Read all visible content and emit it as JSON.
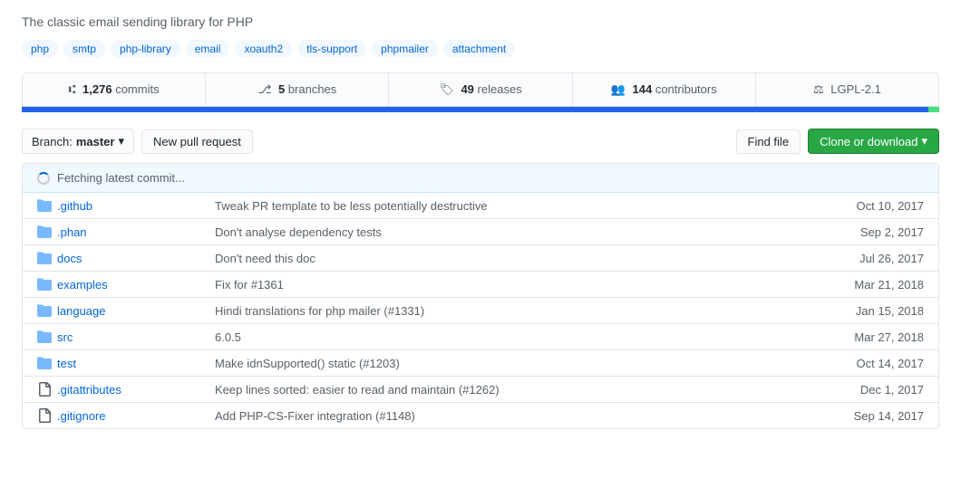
{
  "description": "The classic email sending library for PHP",
  "topics": [
    "php",
    "smtp",
    "php-library",
    "email",
    "xoauth2",
    "tls-support",
    "phpmailer",
    "attachment"
  ],
  "stats": {
    "commits": {
      "count": "1,276",
      "label": "commits"
    },
    "branches": {
      "count": "5",
      "label": "branches"
    },
    "releases": {
      "count": "49",
      "label": "releases"
    },
    "contributors": {
      "count": "144",
      "label": "contributors"
    },
    "license": {
      "label": "LGPL-2.1"
    }
  },
  "toolbar": {
    "branch_label": "Branch:",
    "branch_name": "master",
    "new_pr_label": "New pull request",
    "find_file_label": "Find file",
    "clone_label": "Clone or download"
  },
  "commit_header": "Fetching latest commit...",
  "files": [
    {
      "name": ".github",
      "type": "folder",
      "message": "Tweak PR template to be less potentially destructive",
      "date": "Oct 10, 2017"
    },
    {
      "name": ".phan",
      "type": "folder",
      "message": "Don't analyse dependency tests",
      "date": "Sep 2, 2017"
    },
    {
      "name": "docs",
      "type": "folder",
      "message": "Don't need this doc",
      "date": "Jul 26, 2017"
    },
    {
      "name": "examples",
      "type": "folder",
      "message": "Fix for #1361",
      "date": "Mar 21, 2018"
    },
    {
      "name": "language",
      "type": "folder",
      "message": "Hindi translations for php mailer (#1331)",
      "date": "Jan 15, 2018"
    },
    {
      "name": "src",
      "type": "folder",
      "message": "6.0.5",
      "date": "Mar 27, 2018"
    },
    {
      "name": "test",
      "type": "folder",
      "message": "Make idnSupported() static (#1203)",
      "date": "Oct 14, 2017"
    },
    {
      "name": ".gitattributes",
      "type": "file",
      "message": "Keep lines sorted: easier to read and maintain (#1262)",
      "date": "Dec 1, 2017"
    },
    {
      "name": ".gitignore",
      "type": "file",
      "message": "Add PHP-CS-Fixer integration (#1148)",
      "date": "Sep 14, 2017"
    }
  ],
  "colors": {
    "accent": "#0366d6",
    "green": "#28a745",
    "progress_blue": "#2563eb",
    "progress_green": "#4ade80"
  }
}
